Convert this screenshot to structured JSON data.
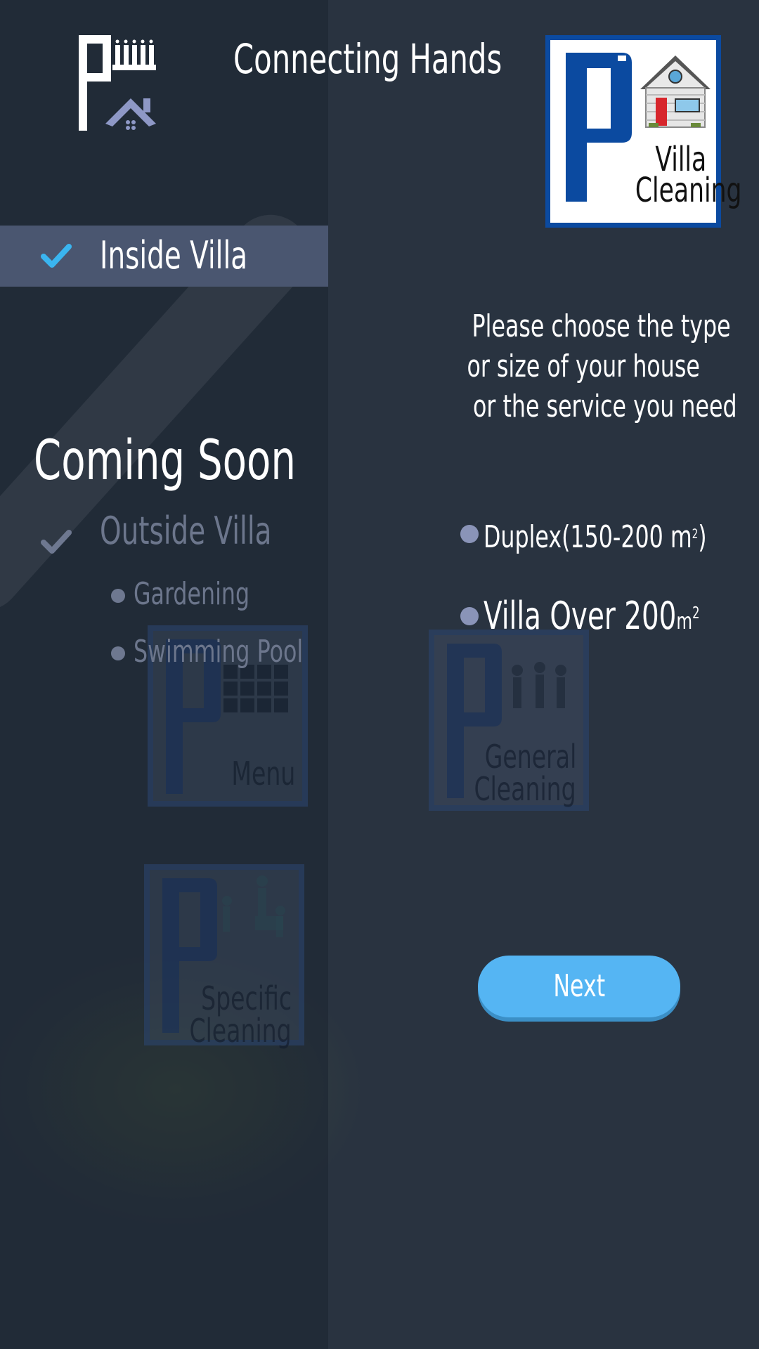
{
  "header": {
    "title": "Connecting Hands",
    "logo_text": "Villa Cleaning",
    "logo_line1": "Villa",
    "logo_line2": "Cleaning"
  },
  "sidebar": {
    "active_item": {
      "label": "Inside Villa",
      "icon": "check-icon",
      "selected": true
    },
    "coming_soon_heading": "Coming Soon",
    "disabled_item": {
      "label": "Outside Villa",
      "icon": "check-icon",
      "subitems": [
        "Gardening",
        "Swimming Pool"
      ]
    }
  },
  "background_tiles": [
    {
      "label": "Menu"
    },
    {
      "label_line1": "General",
      "label_line2": "Cleaning"
    },
    {
      "label_line1": "Specific",
      "label_line2": "Cleaning"
    }
  ],
  "main": {
    "prompt_line1": "Please choose the type",
    "prompt_line2": "or size of your house",
    "prompt_line3": "or the service you need",
    "options": [
      {
        "label": "Duplex(150-200 ",
        "unit": "m",
        "exp": "2",
        "suffix": ")"
      },
      {
        "label": "Villa Over 200",
        "unit": "m",
        "exp": "2",
        "suffix": ""
      }
    ],
    "next_label": "Next"
  },
  "colors": {
    "background": "#293340",
    "sidebar_highlight": "#4a5670",
    "accent": "#55b5f3",
    "check": "#3ab5f0",
    "logo_blue": "#0b4aa0",
    "muted_text": "#6c768c"
  }
}
